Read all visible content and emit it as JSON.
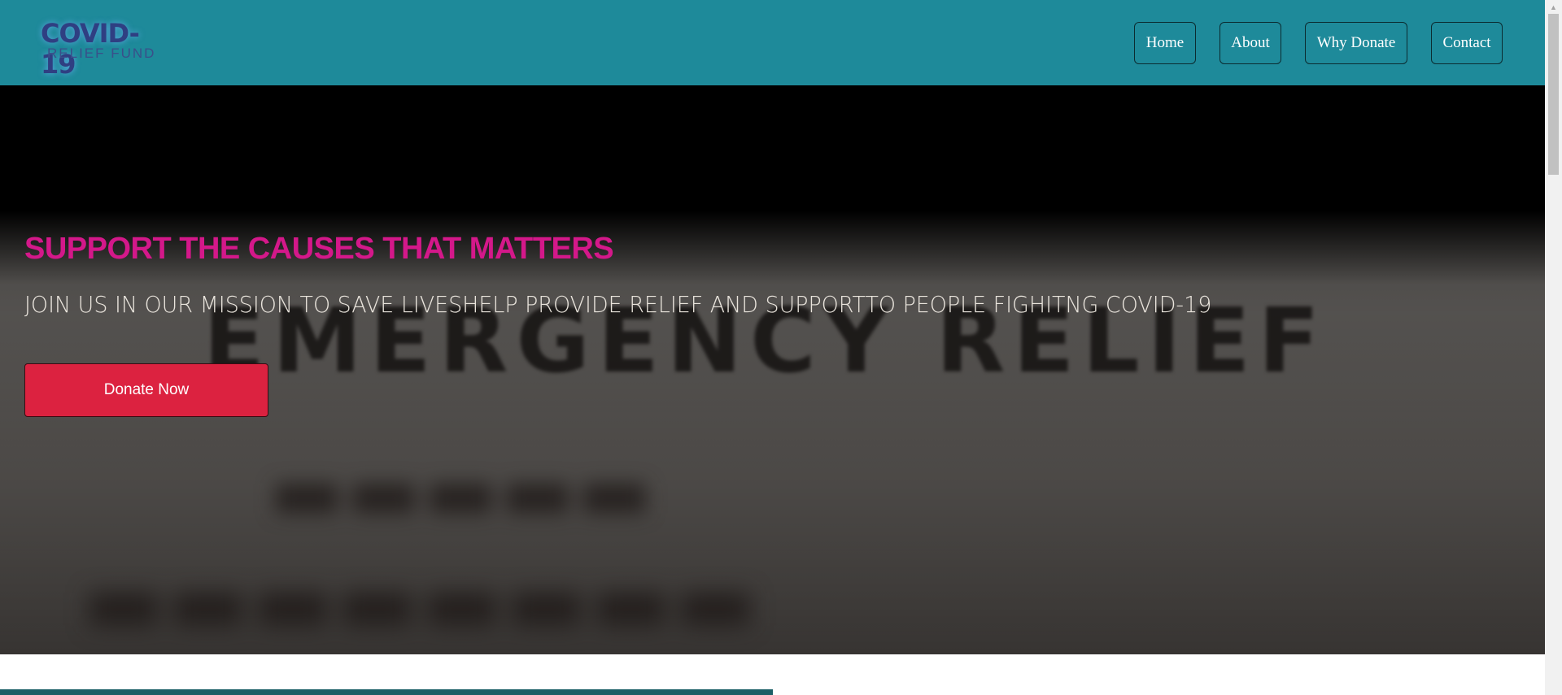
{
  "logo": {
    "title": "COVID-19",
    "subtitle": "RELIEF FUND"
  },
  "nav": {
    "home": "Home",
    "about": "About",
    "why_donate": "Why Donate",
    "contact": "Contact"
  },
  "hero": {
    "title": "SUPPORT THE CAUSES THAT MATTERS",
    "subtitle": "JOIN US IN OUR MISSION TO SAVE LIVESHELP PROVIDE RELIEF AND SUPPORTTO PEOPLE FIGHITNG COVID-19",
    "donate_button": "Donate Now",
    "background_text": "EMERGENCY RELIEF"
  },
  "colors": {
    "header": "#1e8a9a",
    "hero_title": "#d4188a",
    "donate_button": "#dc2240",
    "section_bar": "#1b5f66"
  },
  "icons": {
    "scroll_up": "triangle-up-icon"
  }
}
